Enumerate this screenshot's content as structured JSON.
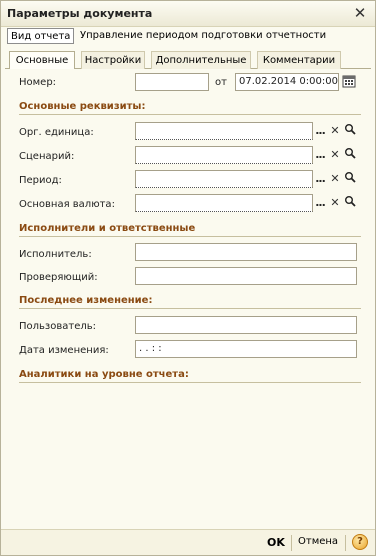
{
  "window": {
    "title": "Параметры документа",
    "close_glyph": "✕"
  },
  "top_tabs": [
    {
      "label": "Вид отчета"
    },
    {
      "label": "Управление периодом подготовки отчетности"
    }
  ],
  "tabs": [
    {
      "label": "Основные"
    },
    {
      "label": "Настройки"
    },
    {
      "label": "Дополнительные"
    },
    {
      "label": "Комментарии"
    }
  ],
  "main": {
    "number_label": "Номер:",
    "number_value": "",
    "date_from_label": "от",
    "date_value": "07.02.2014  0:00:00",
    "sections": {
      "basic": "Основные реквизиты:",
      "executors": "Исполнители и ответственные",
      "last_change": "Последнее изменение:",
      "analytics": "Аналитики на уровне отчета:"
    },
    "fields": {
      "org_unit_label": "Орг. единица:",
      "scenario_label": "Сценарий:",
      "period_label": "Период:",
      "currency_label": "Основная валюта:",
      "executor_label": "Исполнитель:",
      "checker_label": "Проверяющий:",
      "user_label": "Пользователь:",
      "change_date_label": "Дата изменения:",
      "change_date_value": "  .   .        :   :"
    },
    "field_buttons": {
      "select": "...",
      "clear": "✕"
    }
  },
  "footer": {
    "ok_label": "OK",
    "cancel_label": "Отмена",
    "help_label": "?"
  },
  "colors": {
    "section_text": "#8a4a12",
    "background": "#fbfaef"
  }
}
